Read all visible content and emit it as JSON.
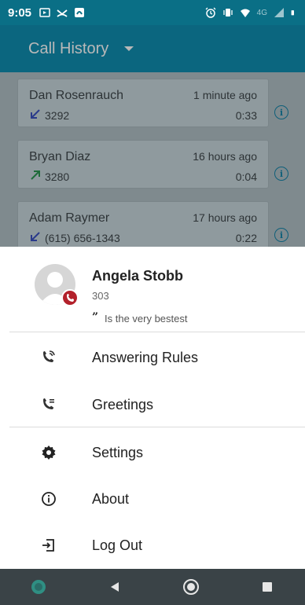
{
  "status_bar": {
    "time": "9:05",
    "network_label": "4G"
  },
  "header": {
    "title": "Call History"
  },
  "calls": [
    {
      "name": "Dan Rosenrauch",
      "time": "1 minute ago",
      "number": "3292",
      "duration": "0:33",
      "direction": "incoming"
    },
    {
      "name": "Bryan Diaz",
      "time": "16 hours ago",
      "number": "3280",
      "duration": "0:04",
      "direction": "outgoing"
    },
    {
      "name": "Adam Raymer",
      "time": "17 hours ago",
      "number": "(615) 656-1343",
      "duration": "0:22",
      "direction": "incoming"
    }
  ],
  "profile": {
    "name": "Angela Stobb",
    "extension": "303",
    "status_message": "Is the very bestest"
  },
  "menu": {
    "answering_rules": "Answering Rules",
    "greetings": "Greetings",
    "settings": "Settings",
    "about": "About",
    "logout": "Log Out"
  },
  "colors": {
    "brand": "#0f8db0",
    "status_bar": "#0a6f86",
    "badge": "#b3212b",
    "nav_bar": "#3a4347"
  }
}
